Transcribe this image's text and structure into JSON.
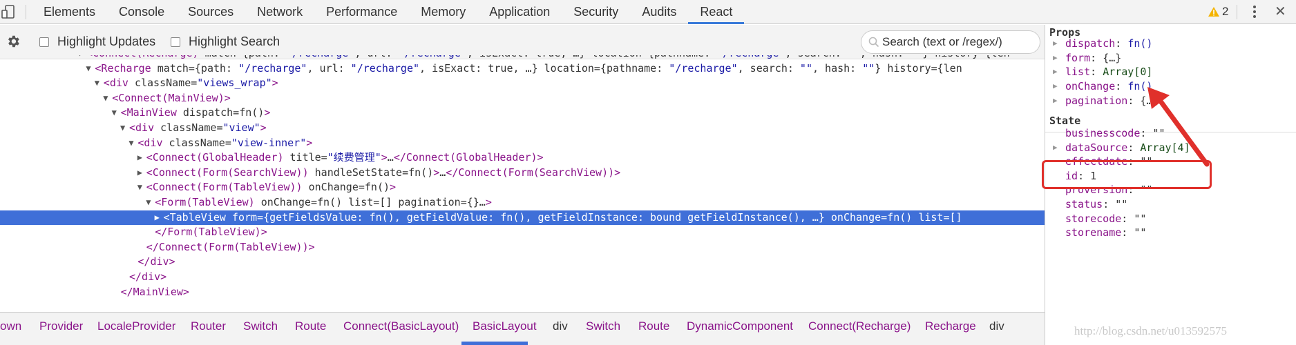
{
  "topbar": {
    "tabs": [
      "Elements",
      "Console",
      "Sources",
      "Network",
      "Performance",
      "Memory",
      "Application",
      "Security",
      "Audits",
      "React"
    ],
    "active_tab": "React",
    "warning_count": "2"
  },
  "toolbar": {
    "highlight_updates": "Highlight Updates",
    "highlight_search": "Highlight Search",
    "search_placeholder": "Search (text or /regex/)"
  },
  "tree": {
    "rows": [
      {
        "depth": 0,
        "arrow": "▼",
        "text": "<Connect(Recharge) match={path: \"/recharge\", url: \"/recharge\", isExact: true, …} location={pathname: \"/recharge\", search: \"\", hash: \"\"} history={len"
      },
      {
        "depth": 1,
        "arrow": "▼",
        "text": "<Recharge match={path: \"/recharge\", url: \"/recharge\", isExact: true, …} location={pathname: \"/recharge\", search: \"\", hash: \"\"} history={len"
      },
      {
        "depth": 2,
        "arrow": "▼",
        "text": "<div className=\"views_wrap\">"
      },
      {
        "depth": 3,
        "arrow": "▼",
        "text": "<Connect(MainView)>"
      },
      {
        "depth": 4,
        "arrow": "▼",
        "text": "<MainView dispatch=fn()>"
      },
      {
        "depth": 5,
        "arrow": "▼",
        "text": "<div className=\"view\">"
      },
      {
        "depth": 6,
        "arrow": "▼",
        "text": "<div className=\"view-inner\">"
      },
      {
        "depth": 7,
        "arrow": "▶",
        "text": "<Connect(GlobalHeader) title=\"续费管理\">…</Connect(GlobalHeader)>"
      },
      {
        "depth": 7,
        "arrow": "▶",
        "text": "<Connect(Form(SearchView)) handleSetState=fn()>…</Connect(Form(SearchView))>"
      },
      {
        "depth": 7,
        "arrow": "▼",
        "text": "<Connect(Form(TableView)) onChange=fn()>"
      },
      {
        "depth": 8,
        "arrow": "▼",
        "text": "<Form(TableView) onChange=fn() list=[] pagination={}…>"
      },
      {
        "depth": 9,
        "arrow": "▶",
        "text": "<TableView form={getFieldsValue: fn(), getFieldValue: fn(), getFieldInstance: bound getFieldInstance(), …} onChange=fn() list=[]",
        "selected": true
      },
      {
        "depth": 8,
        "arrow": "",
        "text": "</Form(TableView)>"
      },
      {
        "depth": 7,
        "arrow": "",
        "text": "</Connect(Form(TableView))>"
      },
      {
        "depth": 6,
        "arrow": "",
        "text": "</div>"
      },
      {
        "depth": 5,
        "arrow": "",
        "text": "</div>"
      },
      {
        "depth": 4,
        "arrow": "",
        "text": "</MainView>"
      }
    ]
  },
  "breadcrumbs": [
    {
      "label": "own",
      "kind": "component"
    },
    {
      "label": "Provider",
      "kind": "component"
    },
    {
      "label": "LocaleProvider",
      "kind": "component"
    },
    {
      "label": "Router",
      "kind": "component"
    },
    {
      "label": "Switch",
      "kind": "component"
    },
    {
      "label": "Route",
      "kind": "component"
    },
    {
      "label": "Connect(BasicLayout)",
      "kind": "component"
    },
    {
      "label": "BasicLayout",
      "kind": "component"
    },
    {
      "label": "div",
      "kind": "dom"
    },
    {
      "label": "Switch",
      "kind": "component"
    },
    {
      "label": "Route",
      "kind": "component"
    },
    {
      "label": "DynamicComponent",
      "kind": "component"
    },
    {
      "label": "Connect(Recharge)",
      "kind": "component"
    },
    {
      "label": "Recharge",
      "kind": "component"
    },
    {
      "label": "div",
      "kind": "dom"
    }
  ],
  "sidebar": {
    "props_title": "Props",
    "props": [
      {
        "key": "dispatch",
        "value": "fn()",
        "type": "fn",
        "expandable": true
      },
      {
        "key": "form",
        "value": "{…}",
        "type": "obj",
        "expandable": true
      },
      {
        "key": "list",
        "value": "Array[0]",
        "type": "arr",
        "expandable": true
      },
      {
        "key": "onChange",
        "value": "fn()",
        "type": "fn",
        "expandable": true
      },
      {
        "key": "pagination",
        "value": "{…}",
        "type": "obj",
        "expandable": true
      }
    ],
    "state_title": "State",
    "state": [
      {
        "key": "businesscode",
        "value": "\"\"",
        "type": "str",
        "expandable": false
      },
      {
        "key": "dataSource",
        "value": "Array[4]",
        "type": "arr",
        "expandable": true
      },
      {
        "key": "effectdate",
        "value": "\"\"",
        "type": "str",
        "expandable": false
      },
      {
        "key": "id",
        "value": "1",
        "type": "num",
        "expandable": false
      },
      {
        "key": "proversion",
        "value": "\"\"",
        "type": "str",
        "expandable": false
      },
      {
        "key": "status",
        "value": "\"\"",
        "type": "str",
        "expandable": false
      },
      {
        "key": "storecode",
        "value": "\"\"",
        "type": "str",
        "expandable": false
      },
      {
        "key": "storename",
        "value": "\"\"",
        "type": "str",
        "expandable": false
      }
    ]
  },
  "watermark": "http://blog.csdn.net/u013592575",
  "colors": {
    "accent": "#3f6fd8",
    "annotation": "#e0302b",
    "tag": "#8a148a"
  }
}
